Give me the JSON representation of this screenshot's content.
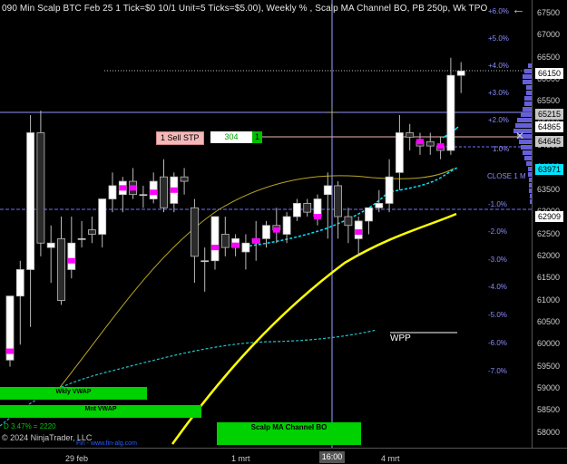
{
  "header": {
    "title": "090 Min Scalp BTC Feb 25 1 Tick=$0 10/1 Unit=5 Ticks=$5.00), Weekly % , Scalp MA Channel BO, PB 250p, Wk TPO",
    "back_icon": "arrow-left-icon"
  },
  "price_axis": {
    "ticks": [
      "67500",
      "67000",
      "66500",
      "66000",
      "65500",
      "65000",
      "64500",
      "64000",
      "63500",
      "63000",
      "62500",
      "62000",
      "61500",
      "61000",
      "60500",
      "60000",
      "59500",
      "59000",
      "58500",
      "58000"
    ],
    "boxes": {
      "last": "66150",
      "b65215": "65215",
      "b64865": "64865",
      "b64645": "64645",
      "b63971": "63971",
      "b62909": "62909"
    },
    "colors": {
      "last": "#ffffff",
      "b65215": "#c8c8c8",
      "b64865": "#ffffff",
      "b64645": "#c8c8c8",
      "b63971": "#00e5ff",
      "b62909": "#ffffff"
    }
  },
  "percent_labels": [
    "+6.0%",
    "+5.0%",
    "+4.0%",
    "+3.0%",
    "+2.0%",
    "1.0%",
    "-1.0%",
    "-2.0%",
    "-3.0%",
    "-4.0%",
    "-5.0%",
    "-6.0%",
    "-7.0%"
  ],
  "order": {
    "side_label": "1 Sell STP",
    "quantity": "304",
    "count": "1"
  },
  "annotations": {
    "close": "CLOSE 1 M",
    "wpp": "WPP",
    "drawdown": "D 3.47% = 2220",
    "copyright": "© 2024 NinjaTrader, LLC",
    "site": "Fin - www.fin-alg.com"
  },
  "bars": {
    "wkly_vwap": "Wkly VWAP",
    "mnt_vwap": "Mnt VWAP",
    "scalp_ma": "Scalp MA Channel BO"
  },
  "time_axis": {
    "dates": [
      "29 feb",
      "1 mrt",
      "4 mrt"
    ],
    "current_time": "16:00"
  },
  "candles": [
    {
      "o": 59650,
      "h": 60400,
      "l": 59500,
      "c": 61100,
      "m": 59850
    },
    {
      "o": 61100,
      "h": 61900,
      "l": 60000,
      "c": 61700,
      "m": null
    },
    {
      "o": 61700,
      "h": 65200,
      "l": 60400,
      "c": 64800,
      "m": null
    },
    {
      "o": 64800,
      "h": 65300,
      "l": 62000,
      "c": 62300,
      "m": null
    },
    {
      "o": 62200,
      "h": 62700,
      "l": 61400,
      "c": 62300,
      "m": null
    },
    {
      "o": 62400,
      "h": 62900,
      "l": 60900,
      "c": 61000,
      "m": null
    },
    {
      "o": 61700,
      "h": 62900,
      "l": 61500,
      "c": 62300,
      "m": 61900
    },
    {
      "o": 62400,
      "h": 62800,
      "l": 62200,
      "c": 62400,
      "m": null
    },
    {
      "o": 62600,
      "h": 62900,
      "l": 62300,
      "c": 62500,
      "m": null
    },
    {
      "o": 62500,
      "h": 63200,
      "l": 62200,
      "c": 63300,
      "m": null
    },
    {
      "o": 63300,
      "h": 63900,
      "l": 63000,
      "c": 63600,
      "m": null
    },
    {
      "o": 63400,
      "h": 63800,
      "l": 63000,
      "c": 63700,
      "m": 63550
    },
    {
      "o": 63700,
      "h": 64000,
      "l": 63300,
      "c": 63400,
      "m": 63550
    },
    {
      "o": 63400,
      "h": 63600,
      "l": 63100,
      "c": 63400,
      "m": null
    },
    {
      "o": 63300,
      "h": 63900,
      "l": 63200,
      "c": 63700,
      "m": 63450
    },
    {
      "o": 63800,
      "h": 64200,
      "l": 63000,
      "c": 63100,
      "m": null
    },
    {
      "o": 63200,
      "h": 63900,
      "l": 63000,
      "c": 63800,
      "m": 63500
    },
    {
      "o": 63800,
      "h": 64000,
      "l": 63400,
      "c": 63700,
      "m": null
    },
    {
      "o": 63100,
      "h": 63300,
      "l": 61400,
      "c": 62000,
      "m": null
    },
    {
      "o": 61900,
      "h": 62200,
      "l": 61200,
      "c": 61900,
      "m": null
    },
    {
      "o": 61900,
      "h": 62900,
      "l": 61700,
      "c": 62900,
      "m": 62200
    },
    {
      "o": 62500,
      "h": 62900,
      "l": 62000,
      "c": 62200,
      "m": null
    },
    {
      "o": 62200,
      "h": 62500,
      "l": 62000,
      "c": 62400,
      "m": 62250
    },
    {
      "o": 62100,
      "h": 62500,
      "l": 61700,
      "c": 62300,
      "m": null
    },
    {
      "o": 62400,
      "h": 62800,
      "l": 61900,
      "c": 62300,
      "m": 62350
    },
    {
      "o": 62400,
      "h": 62800,
      "l": 62200,
      "c": 62700,
      "m": null
    },
    {
      "o": 62700,
      "h": 63100,
      "l": 62300,
      "c": 62600,
      "m": 62600
    },
    {
      "o": 62500,
      "h": 63000,
      "l": 62300,
      "c": 62900,
      "m": null
    },
    {
      "o": 62900,
      "h": 63300,
      "l": 62800,
      "c": 63200,
      "m": null
    },
    {
      "o": 63200,
      "h": 63300,
      "l": 62900,
      "c": 63000,
      "m": null
    },
    {
      "o": 62900,
      "h": 63400,
      "l": 62700,
      "c": 63300,
      "m": 62900
    },
    {
      "o": 63400,
      "h": 63900,
      "l": 62400,
      "c": 63600,
      "m": null
    },
    {
      "o": 63600,
      "h": 63700,
      "l": 62400,
      "c": 62900,
      "m": null
    },
    {
      "o": 62900,
      "h": 63100,
      "l": 62300,
      "c": 62700,
      "m": null
    },
    {
      "o": 62400,
      "h": 62900,
      "l": 62000,
      "c": 62800,
      "m": 62550
    },
    {
      "o": 62800,
      "h": 63100,
      "l": 62500,
      "c": 63100,
      "m": null
    },
    {
      "o": 63100,
      "h": 63500,
      "l": 63000,
      "c": 63200,
      "m": null
    },
    {
      "o": 63200,
      "h": 64200,
      "l": 63000,
      "c": 63800,
      "m": null
    },
    {
      "o": 63900,
      "h": 65200,
      "l": 63500,
      "c": 64800,
      "m": null
    },
    {
      "o": 64800,
      "h": 65000,
      "l": 64400,
      "c": 64700,
      "m": null
    },
    {
      "o": 64600,
      "h": 64800,
      "l": 64300,
      "c": 64500,
      "m": 64600
    },
    {
      "o": 64600,
      "h": 64800,
      "l": 64300,
      "c": 64500,
      "m": null
    },
    {
      "o": 64500,
      "h": 64700,
      "l": 64200,
      "c": 64400,
      "m": 64500
    },
    {
      "o": 64400,
      "h": 66500,
      "l": 64300,
      "c": 66100,
      "m": null
    },
    {
      "o": 66100,
      "h": 66400,
      "l": 65700,
      "c": 66200,
      "m": null
    }
  ]
}
